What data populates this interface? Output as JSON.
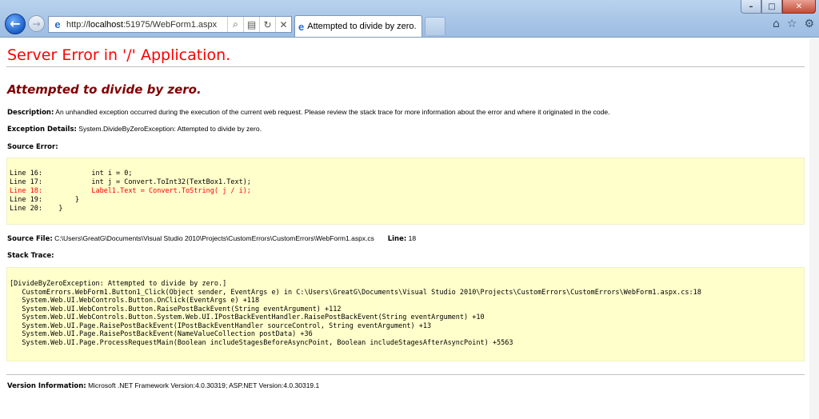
{
  "browser": {
    "address_prefix": "http://",
    "address_host": "localhost",
    "address_rest": ":51975/WebForm1.aspx",
    "tab_title": "Attempted to divide by zero.",
    "icons": {
      "back": "back-arrow-icon",
      "forward": "forward-arrow-icon",
      "search": "search-icon",
      "compat": "compatibility-icon",
      "refresh": "refresh-icon",
      "stop": "stop-icon",
      "home": "home-icon",
      "favorites": "star-icon",
      "tools": "gear-icon"
    }
  },
  "page": {
    "title": "Server Error in '/' Application.",
    "error_title": "Attempted to divide by zero.",
    "description_label": "Description:",
    "description_text": "An unhandled exception occurred during the execution of the current web request. Please review the stack trace for more information about the error and where it originated in the code.",
    "exception_label": "Exception Details:",
    "exception_text": "System.DivideByZeroException: Attempted to divide by zero.",
    "source_error_label": "Source Error:",
    "source_lines": [
      {
        "text": "Line 16:            int i = 0;",
        "highlight": false
      },
      {
        "text": "Line 17:            int j = Convert.ToInt32(TextBox1.Text);",
        "highlight": false
      },
      {
        "text": "Line 18:            Label1.Text = Convert.ToString( j / i);",
        "highlight": true
      },
      {
        "text": "Line 19:        }",
        "highlight": false
      },
      {
        "text": "Line 20:    }",
        "highlight": false
      }
    ],
    "source_file_label": "Source File:",
    "source_file_path": "C:\\Users\\GreatG\\Documents\\Visual Studio 2010\\Projects\\CustomErrors\\CustomErrors\\WebForm1.aspx.cs",
    "line_label": "Line:",
    "line_value": "18",
    "stack_trace_label": "Stack Trace:",
    "stack_lines": [
      "[DivideByZeroException: Attempted to divide by zero.]",
      "   CustomErrors.WebForm1.Button1_Click(Object sender, EventArgs e) in C:\\Users\\GreatG\\Documents\\Visual Studio 2010\\Projects\\CustomErrors\\CustomErrors\\WebForm1.aspx.cs:18",
      "   System.Web.UI.WebControls.Button.OnClick(EventArgs e) +118",
      "   System.Web.UI.WebControls.Button.RaisePostBackEvent(String eventArgument) +112",
      "   System.Web.UI.WebControls.Button.System.Web.UI.IPostBackEventHandler.RaisePostBackEvent(String eventArgument) +10",
      "   System.Web.UI.Page.RaisePostBackEvent(IPostBackEventHandler sourceControl, String eventArgument) +13",
      "   System.Web.UI.Page.RaisePostBackEvent(NameValueCollection postData) +36",
      "   System.Web.UI.Page.ProcessRequestMain(Boolean includeStagesBeforeAsyncPoint, Boolean includeStagesAfterAsyncPoint) +5563"
    ],
    "version_label": "Version Information:",
    "version_text": "Microsoft .NET Framework Version:4.0.30319; ASP.NET Version:4.0.30319.1"
  }
}
